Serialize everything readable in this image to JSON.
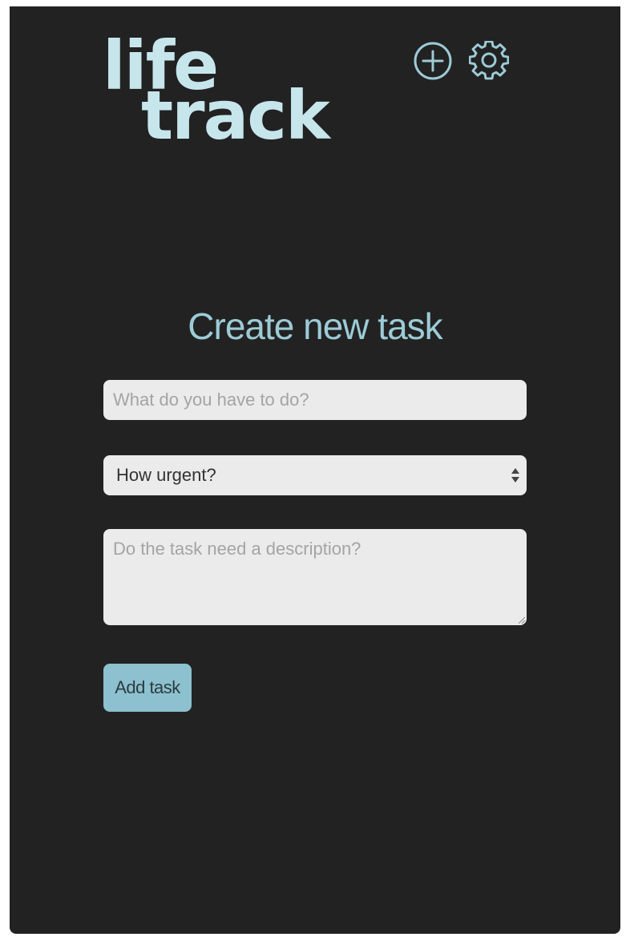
{
  "app": {
    "logo_line1": "life",
    "logo_line2": "track"
  },
  "header": {
    "add_icon": "plus-circle-icon",
    "settings_icon": "gear-icon"
  },
  "form": {
    "title": "Create new task",
    "task_placeholder": "What do you have to do?",
    "task_value": "",
    "urgency_selected": "How urgent?",
    "description_placeholder": "Do the task need a description?",
    "description_value": "",
    "submit_label": "Add task"
  },
  "colors": {
    "background": "#222222",
    "accent": "#9ccbd6",
    "logo": "#c6e6ec",
    "field_background": "#ebebeb",
    "button_background": "#8dc1cf"
  }
}
